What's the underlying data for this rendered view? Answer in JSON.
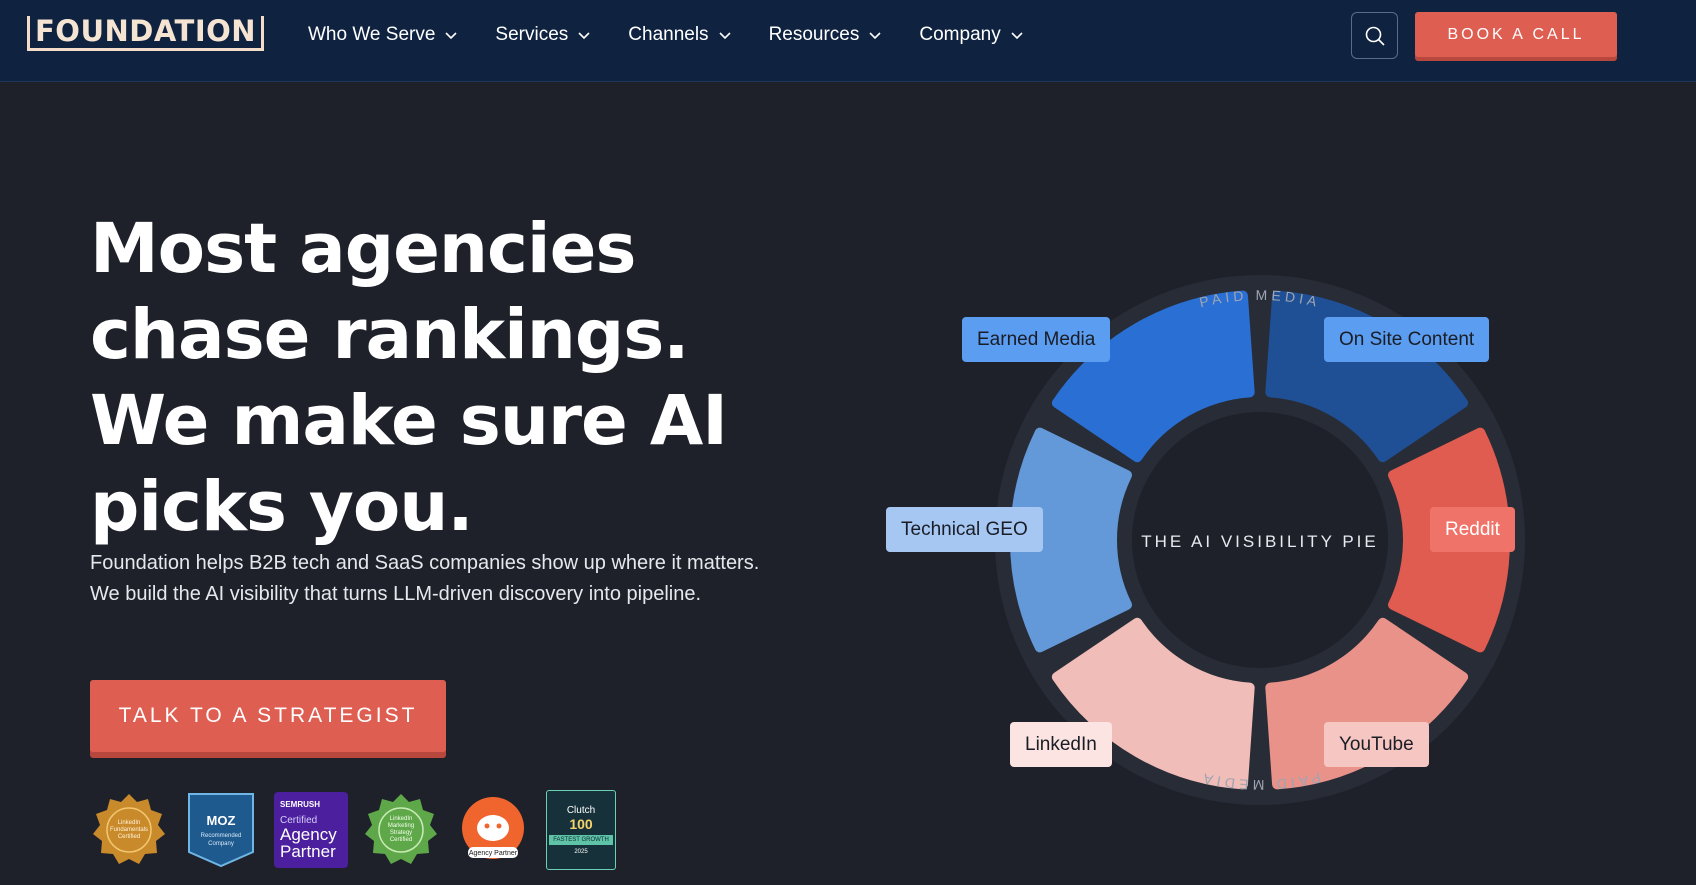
{
  "header": {
    "logo": "FOUNDATION",
    "nav": [
      {
        "label": "Who We Serve"
      },
      {
        "label": "Services"
      },
      {
        "label": "Channels"
      },
      {
        "label": "Resources"
      },
      {
        "label": "Company"
      }
    ],
    "book_call": "BOOK A CALL"
  },
  "hero": {
    "title": "Most agencies chase rankings. We make sure AI picks you.",
    "description_1": "Foundation helps B2B tech and SaaS companies show up where it matters.",
    "description_2": "We build the AI visibility that turns LLM-driven discovery into pipeline.",
    "cta": "TALK TO A STRATEGIST"
  },
  "badges": {
    "linkedin_fundamentals": "LinkedIn Fundamentals Certified",
    "moz_top": "MOZ",
    "moz_bottom": "Recommended Company",
    "semrush_brand": "SEMRUSH",
    "semrush_cert": "Certified",
    "semrush_agency": "Agency",
    "semrush_partner": "Partner",
    "linkedin_marketing": "LinkedIn Marketing Strategy Certified",
    "reddit_partner": "Agency Partner",
    "clutch_brand": "Clutch",
    "clutch_rank": "100",
    "clutch_ribbon": "FASTEST GROWTH",
    "clutch_year": "2025"
  },
  "pie": {
    "center": "THE AI VISIBILITY PIE",
    "ring_top": "PAID MEDIA",
    "ring_bottom": "PAID MEDIA",
    "segments": [
      {
        "label": "Earned Media",
        "color": "#2a6fd3",
        "label_bg": "#5b9df0"
      },
      {
        "label": "On Site Content",
        "color": "#1f4f94",
        "label_bg": "#5b9df0"
      },
      {
        "label": "Reddit",
        "color": "#e05c50",
        "label_bg": "#ef7368"
      },
      {
        "label": "YouTube",
        "color": "#e9928a",
        "label_bg": "#f6c7c2"
      },
      {
        "label": "LinkedIn",
        "color": "#f0bdb8",
        "label_bg": "#fbe4e1"
      },
      {
        "label": "Technical GEO",
        "color": "#6399d9",
        "label_bg": "#a5c7f2"
      }
    ]
  }
}
